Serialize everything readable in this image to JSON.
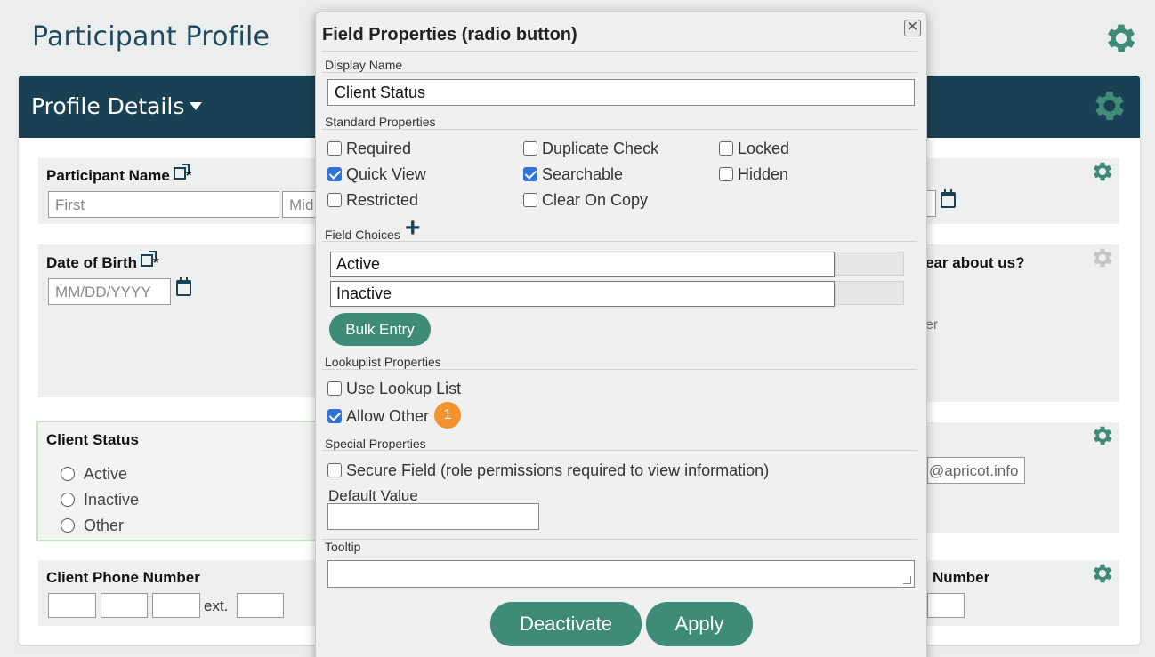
{
  "page": {
    "title": "Participant Profile"
  },
  "panel": {
    "title": "Profile Details"
  },
  "cards": {
    "name": {
      "label": "Participant Name",
      "required": "*",
      "first_placeholder": "First",
      "middle_placeholder": "Mid"
    },
    "dob": {
      "label": "Date of Birth",
      "required": "*",
      "placeholder": "MM/DD/YYYY"
    },
    "status": {
      "label": "Client Status",
      "options": [
        "Active",
        "Inactive",
        "Other"
      ]
    },
    "phone": {
      "label": "Client Phone Number",
      "ext_label": "ext."
    },
    "hear": {
      "label": "ear about us?",
      "partial_text": "er"
    },
    "email": {
      "value": "@apricot.info"
    },
    "number": {
      "label": "Number"
    }
  },
  "modal": {
    "title": "Field Properties (radio button)",
    "close_label": "✕",
    "display_name_label": "Display Name",
    "display_name_value": "Client Status",
    "standard_label": "Standard Properties",
    "standard": [
      {
        "label": "Required",
        "checked": false
      },
      {
        "label": "Duplicate Check",
        "checked": false
      },
      {
        "label": "Locked",
        "checked": false
      },
      {
        "label": "Quick View",
        "checked": true
      },
      {
        "label": "Searchable",
        "checked": true
      },
      {
        "label": "Hidden",
        "checked": false
      },
      {
        "label": "Restricted",
        "checked": false
      },
      {
        "label": "Clear On Copy",
        "checked": false
      }
    ],
    "field_choices_label": "Field Choices",
    "add_icon": "plus-icon",
    "choices": [
      "Active",
      "Inactive"
    ],
    "bulk_entry_label": "Bulk Entry",
    "lookup_label": "Lookuplist Properties",
    "use_lookup": {
      "label": "Use Lookup List",
      "checked": false
    },
    "allow_other": {
      "label": "Allow Other",
      "checked": true,
      "badge": "1"
    },
    "special_label": "Special Properties",
    "secure_field": {
      "label": "Secure Field (role permissions required to view information)",
      "checked": false
    },
    "default_value_label": "Default Value",
    "default_value": "",
    "tooltip_label": "Tooltip",
    "tooltip_value": "",
    "deactivate_label": "Deactivate",
    "apply_label": "Apply"
  },
  "colors": {
    "header": "#1a4153",
    "accent": "#3e8c78",
    "badge": "#f4922e",
    "checkbox": "#2f74d9"
  }
}
